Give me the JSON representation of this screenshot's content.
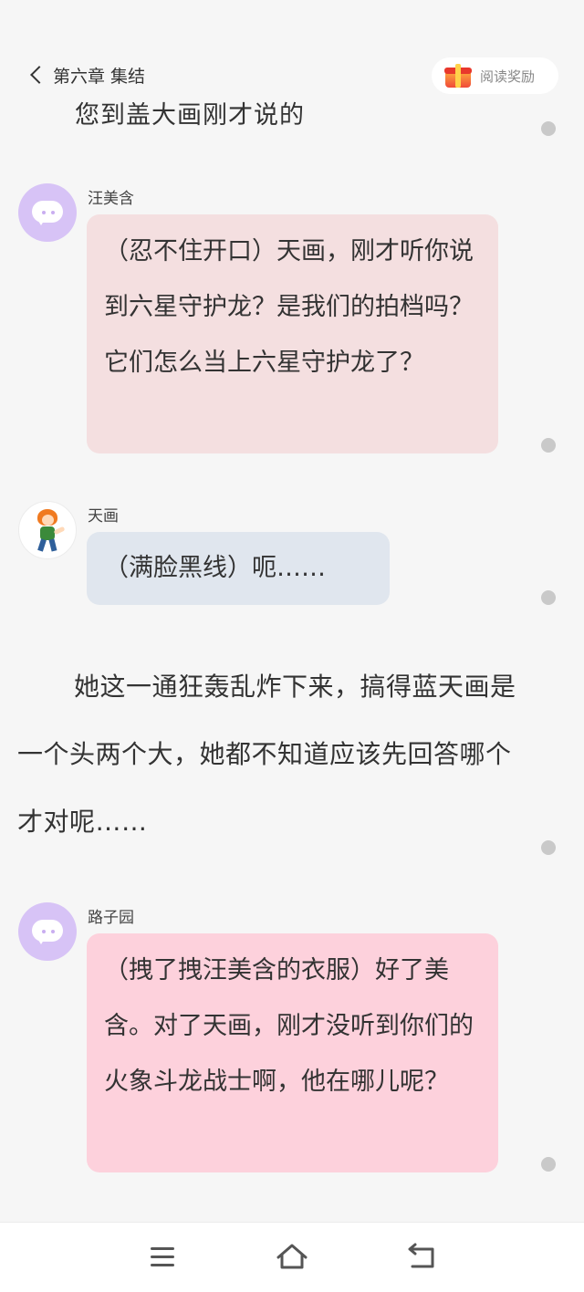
{
  "header": {
    "chapter_title": "第六章 集结",
    "reward_label": "阅读奖励",
    "back_icon": "chevron-left-icon",
    "reward_icon": "gift-box-icon"
  },
  "clipped_line": "您到盖大画刚才说的",
  "messages": [
    {
      "speaker": "汪美含",
      "text": "（忍不住开口）天画，刚才听你说到六星守护龙？是我们的拍档吗？它们怎么当上六星守护龙了？"
    },
    {
      "speaker": "天画",
      "text": "（满脸黑线）呃……"
    },
    {
      "speaker": "路子园",
      "text": "（拽了拽汪美含的衣服）好了美含。对了天画，刚才没听到你们的火象斗龙战士啊，他在哪儿呢？"
    }
  ],
  "narration": "她这一通狂轰乱炸下来，搞得蓝天画是一个头两个大，她都不知道应该先回答哪个才对呢……",
  "colors": {
    "bubble_1": "#f4dfe0",
    "bubble_2": "#e0e6ee",
    "bubble_3": "#fdd1dc",
    "avatar_bot": "#d7c3f6"
  },
  "nav": {
    "menu_icon": "menu-icon",
    "home_icon": "home-icon",
    "back_icon": "back-icon"
  }
}
